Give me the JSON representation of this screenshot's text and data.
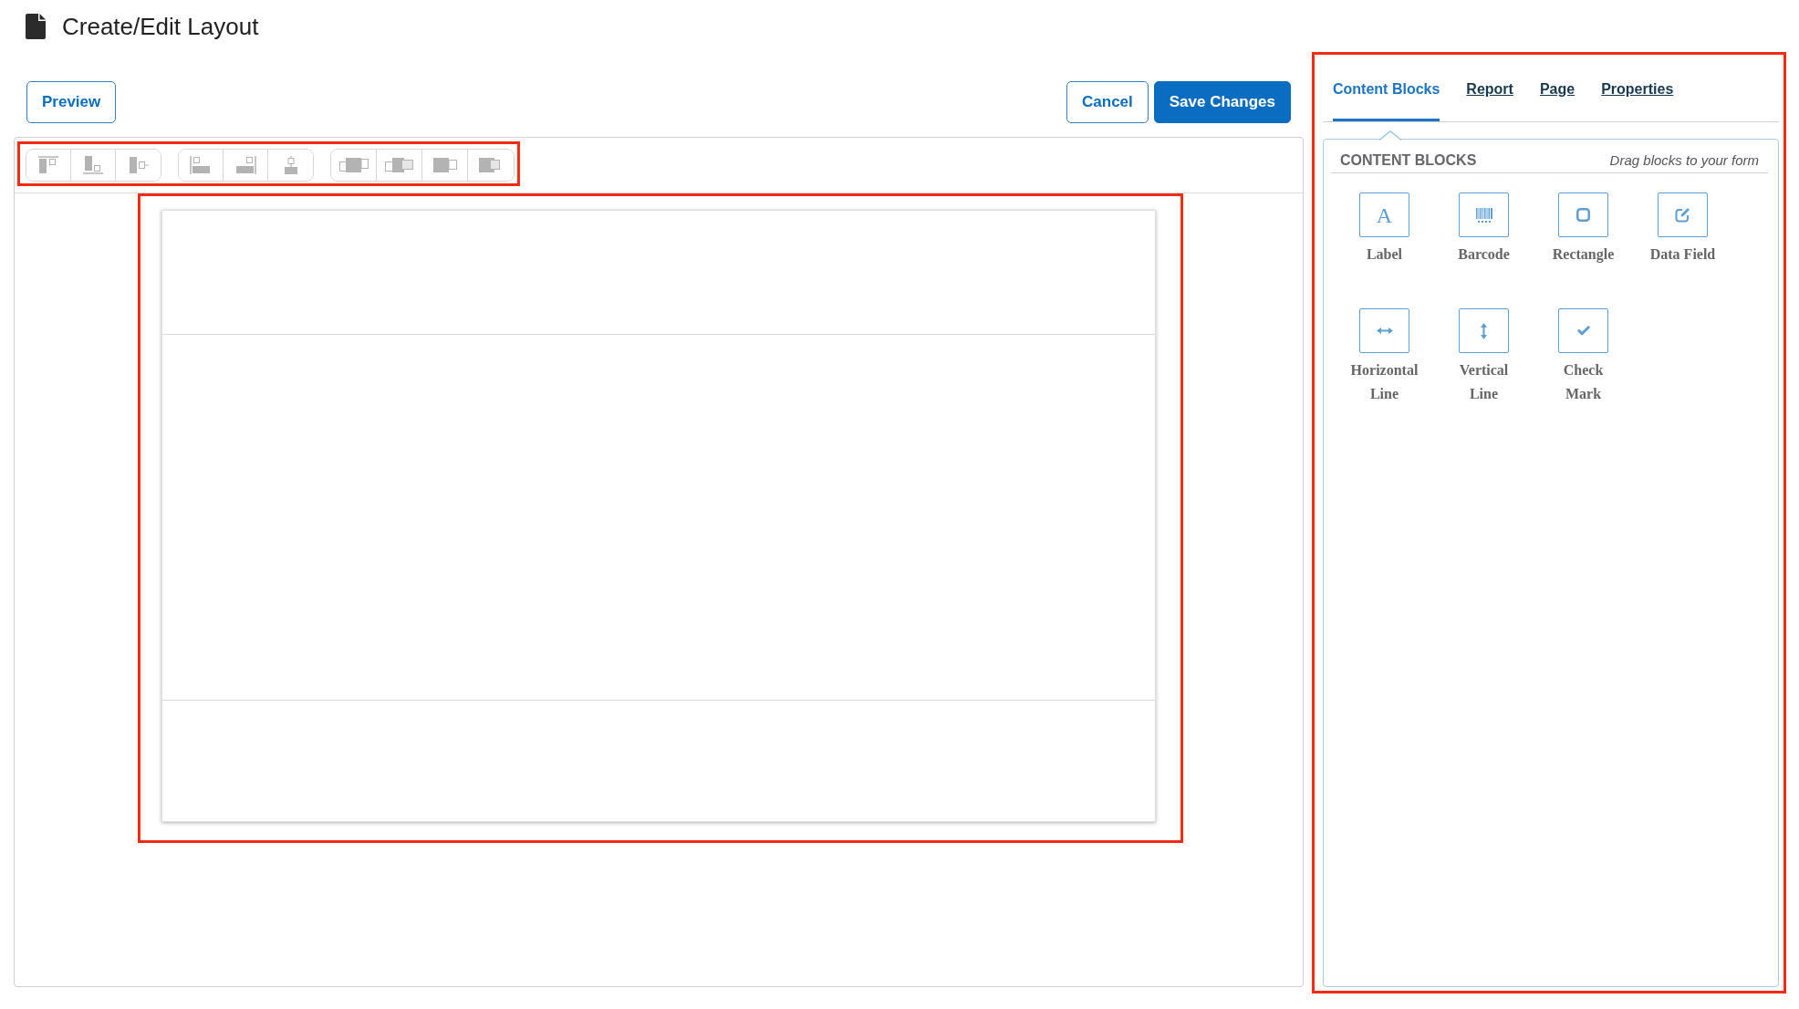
{
  "header": {
    "title": "Create/Edit Layout"
  },
  "actions": {
    "left": [
      {
        "label": "Preview",
        "kind": "outline"
      }
    ],
    "right": [
      {
        "label": "Cancel",
        "kind": "outline"
      },
      {
        "label": "Save Changes",
        "kind": "primary"
      }
    ]
  },
  "editor": {
    "toolbar": {
      "highlighted": true,
      "groups": [
        {
          "buttons": [
            {
              "kind": "align-top"
            },
            {
              "kind": "align-bottom"
            },
            {
              "kind": "align-middle"
            }
          ]
        },
        {
          "buttons": [
            {
              "kind": "align-left"
            },
            {
              "kind": "align-right"
            },
            {
              "kind": "align-center"
            }
          ]
        },
        {
          "buttons": [
            {
              "kind": "spread"
            },
            {
              "kind": "overlap"
            },
            {
              "kind": "adjacent"
            },
            {
              "kind": "stacked"
            }
          ]
        }
      ]
    },
    "canvas": {
      "highlighted": true
    }
  },
  "panel": {
    "highlighted": true,
    "tabs": [
      {
        "label": "Content Blocks",
        "selected": true
      },
      {
        "label": "Report",
        "selected": false
      },
      {
        "label": "Page",
        "selected": false
      },
      {
        "label": "Properties",
        "selected": false
      }
    ],
    "content_blocks": {
      "title": "CONTENT BLOCKS",
      "hint": "Drag blocks to your form",
      "blocks": [
        {
          "label": "Label",
          "kind": "letter",
          "glyph": "A"
        },
        {
          "label": "Barcode",
          "kind": "barcode"
        },
        {
          "label": "Rectangle",
          "kind": "rectangle"
        },
        {
          "label": "Data Field",
          "kind": "data-field"
        },
        {
          "label": "Horizontal Line",
          "kind": "horizontal-line"
        },
        {
          "label": "Vertical Line",
          "kind": "vertical-line"
        },
        {
          "label": "Check Mark",
          "kind": "check-mark"
        }
      ]
    }
  }
}
